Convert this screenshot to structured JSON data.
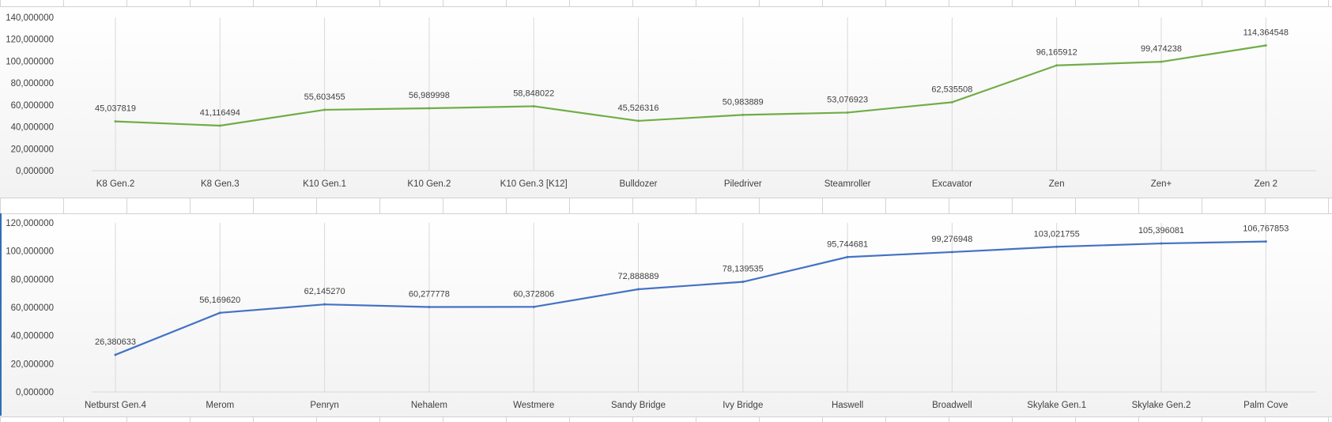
{
  "colors": {
    "series1": "#70ad47",
    "series2": "#4472c4",
    "gridline": "#d9d9d9",
    "axis": "#d9d9d9",
    "text": "#404040"
  },
  "chart_data": [
    {
      "type": "line",
      "categories": [
        "K8 Gen.2",
        "K8 Gen.3",
        "K10 Gen.1",
        "K10 Gen.2",
        "K10 Gen.3 [K12]",
        "Bulldozer",
        "Piledriver",
        "Steamroller",
        "Excavator",
        "Zen",
        "Zen+",
        "Zen 2"
      ],
      "series": [
        {
          "values": [
            45.037819,
            41.116494,
            55.603455,
            56.989998,
            58.848022,
            45.526316,
            50.983889,
            53.076923,
            62.535508,
            96.165912,
            99.474238,
            114.364548
          ],
          "labels": [
            "45,037819",
            "41,116494",
            "55,603455",
            "56,989998",
            "58,848022",
            "45,526316",
            "50,983889",
            "53,076923",
            "62,535508",
            "96,165912",
            "99,474238",
            "114,364548"
          ]
        }
      ],
      "ylim": [
        0,
        140
      ],
      "yticks": [
        0,
        20,
        40,
        60,
        80,
        100,
        120,
        140
      ],
      "ytick_labels": [
        "0,000000",
        "20,000000",
        "40,000000",
        "60,000000",
        "80,000000",
        "100,000000",
        "120,000000",
        "140,000000"
      ],
      "grid": "vertical",
      "title": "",
      "xlabel": "",
      "ylabel": ""
    },
    {
      "type": "line",
      "categories": [
        "Netburst Gen.4",
        "Merom",
        "Penryn",
        "Nehalem",
        "Westmere",
        "Sandy Bridge",
        "Ivy Bridge",
        "Haswell",
        "Broadwell",
        "Skylake Gen.1",
        "Skylake Gen.2",
        "Palm Cove"
      ],
      "series": [
        {
          "values": [
            26.380633,
            56.16962,
            62.14527,
            60.277778,
            60.372806,
            72.888889,
            78.139535,
            95.744681,
            99.276948,
            103.021755,
            105.396081,
            106.767853
          ],
          "labels": [
            "26,380633",
            "56,169620",
            "62,145270",
            "60,277778",
            "60,372806",
            "72,888889",
            "78,139535",
            "95,744681",
            "99,276948",
            "103,021755",
            "105,396081",
            "106,767853"
          ]
        }
      ],
      "ylim": [
        0,
        120
      ],
      "yticks": [
        0,
        20,
        40,
        60,
        80,
        100,
        120
      ],
      "ytick_labels": [
        "0,000000",
        "20,000000",
        "40,000000",
        "60,000000",
        "80,000000",
        "100,000000",
        "120,000000"
      ],
      "grid": "vertical",
      "title": "",
      "xlabel": "",
      "ylabel": ""
    }
  ]
}
